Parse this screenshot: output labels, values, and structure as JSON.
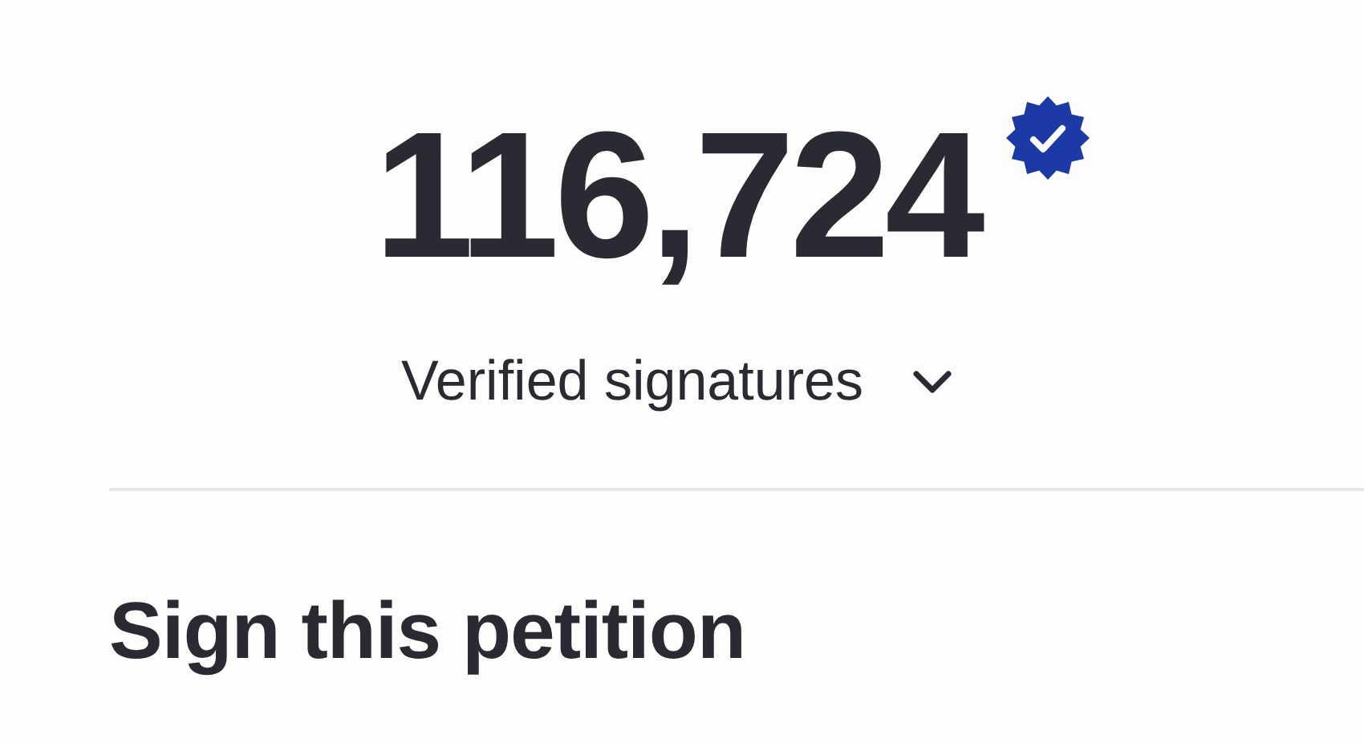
{
  "signature_count": {
    "value": "116,724",
    "verified": true
  },
  "signatures_toggle": {
    "label": "Verified signatures",
    "expanded": false
  },
  "heading": "Sign this petition"
}
